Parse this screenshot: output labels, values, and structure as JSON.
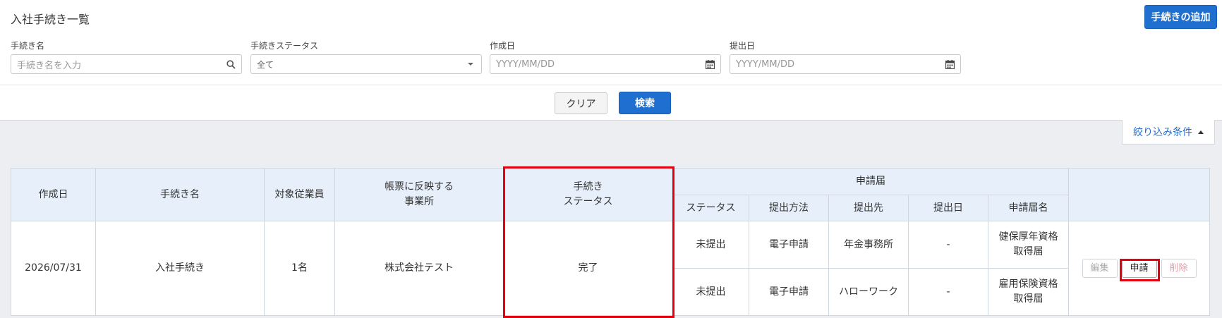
{
  "header": {
    "title": "入社手続き一覧",
    "add_button": "手続きの追加"
  },
  "filters": {
    "procedure_name": {
      "label": "手続き名",
      "placeholder": "手続き名を入力"
    },
    "status": {
      "label": "手続きステータス",
      "value": "全て"
    },
    "created_date": {
      "label": "作成日",
      "placeholder": "YYYY/MM/DD"
    },
    "submitted_date": {
      "label": "提出日",
      "placeholder": "YYYY/MM/DD"
    }
  },
  "actions": {
    "clear": "クリア",
    "search": "検索",
    "filter_toggle": "絞り込み条件"
  },
  "table": {
    "headers": {
      "created": "作成日",
      "name": "手続き名",
      "employees": "対象従業員",
      "office_line1": "帳票に反映する",
      "office_line2": "事業所",
      "status_line1": "手続き",
      "status_line2": "ステータス",
      "application_group": "申請届",
      "sub": [
        "ステータス",
        "提出方法",
        "提出先",
        "提出日",
        "申請届名"
      ]
    },
    "row": {
      "created": "2026/07/31",
      "name": "入社手続き",
      "employees": "1名",
      "office": "株式会社テスト",
      "status": "完了",
      "forms": [
        {
          "status": "未提出",
          "method": "電子申請",
          "destination": "年金事務所",
          "date": "-",
          "name_line1": "健保厚年資格",
          "name_line2": "取得届"
        },
        {
          "status": "未提出",
          "method": "電子申請",
          "destination": "ハローワーク",
          "date": "-",
          "name_line1": "雇用保険資格",
          "name_line2": "取得届"
        }
      ],
      "buttons": {
        "edit": "編集",
        "apply": "申請",
        "delete": "削除"
      }
    }
  },
  "colors": {
    "primary": "#1f6fd1",
    "header_bg": "#e7f0fa",
    "highlight": "#e3000f",
    "link": "#2a6fc9"
  }
}
